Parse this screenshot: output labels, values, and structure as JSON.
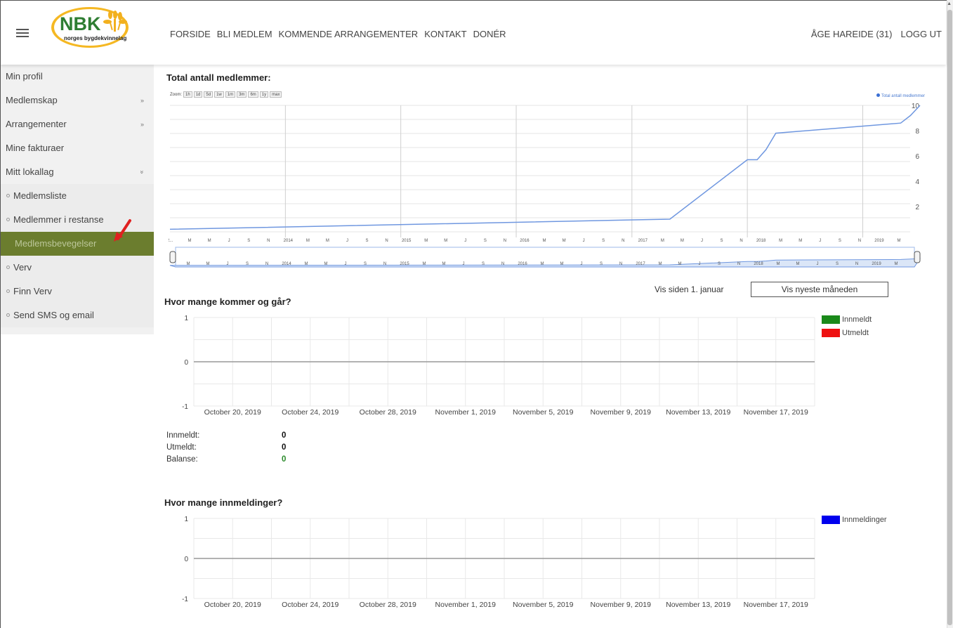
{
  "header": {
    "logo_title": "NBK",
    "logo_subtitle": "norges bygdekvinnelag",
    "nav": [
      "FORSIDE",
      "BLI MEDLEM",
      "KOMMENDE ARRANGEMENTER",
      "KONTAKT",
      "DONÉR"
    ],
    "user": "ÅGE HAREIDE (31)",
    "logout": "LOGG UT"
  },
  "sidebar": {
    "items": [
      {
        "label": "Min profil",
        "arrow": ""
      },
      {
        "label": "Medlemskap",
        "arrow": "»"
      },
      {
        "label": "Arrangementer",
        "arrow": "»"
      },
      {
        "label": "Mine fakturaer",
        "arrow": ""
      },
      {
        "label": "Mitt lokallag",
        "arrow": "»"
      }
    ],
    "sub_items": [
      "Medlemsliste",
      "Medlemmer i restanse",
      "Medlemsbevegelser",
      "Verv",
      "Finn Verv",
      "Send SMS og email"
    ]
  },
  "colors": {
    "accent": "#6b7d2e",
    "line": "#6f97e0",
    "innmeldt": "#1a8a1a",
    "utmeldt": "#ee1111",
    "innmeldinger": "#0000ee"
  },
  "total": {
    "title": "Total antall medlemmer:",
    "zoom_label": "Zoom:",
    "zoom_buttons": [
      "1h",
      "1d",
      "5d",
      "1w",
      "1m",
      "3m",
      "6m",
      "1y",
      "max"
    ],
    "legend": "Total antall medlemmer",
    "y_ticks": [
      "10",
      "8",
      "6",
      "4",
      "2"
    ],
    "x_ticks": [
      "2...",
      "M",
      "M",
      "J",
      "S",
      "N",
      "2014",
      "M",
      "M",
      "J",
      "S",
      "N",
      "2015",
      "M",
      "M",
      "J",
      "S",
      "N",
      "2016",
      "M",
      "M",
      "J",
      "S",
      "N",
      "2017",
      "M",
      "M",
      "J",
      "S",
      "N",
      "2018",
      "M",
      "M",
      "J",
      "S",
      "N",
      "2019",
      "M"
    ],
    "nav_ticks": [
      "M",
      "M",
      "J",
      "S",
      "N",
      "2014",
      "M",
      "M",
      "J",
      "S",
      "N",
      "2015",
      "M",
      "M",
      "J",
      "S",
      "N",
      "2016",
      "M",
      "M",
      "J",
      "S",
      "N",
      "2017",
      "M",
      "M",
      "J",
      "S",
      "N",
      "2018",
      "M",
      "M",
      "J",
      "S",
      "N",
      "2019",
      "M"
    ]
  },
  "chart_data": [
    {
      "type": "line",
      "title": "Total antall medlemmer:",
      "series": [
        {
          "name": "Total antall medlemmer",
          "x": [
            "2013-01",
            "2017-05",
            "2018-01",
            "2018-02",
            "2018-03",
            "2018-04",
            "2019-05",
            "2019-06",
            "2019-07"
          ],
          "values": [
            0.2,
            1.0,
            5.7,
            5.7,
            6.5,
            7.8,
            8.6,
            9.2,
            10
          ]
        }
      ],
      "ylim": [
        0,
        10
      ]
    },
    {
      "type": "bar",
      "title": "Hvor mange kommer og går?",
      "categories": [
        "October 20, 2019",
        "October 24, 2019",
        "October 28, 2019",
        "November 1, 2019",
        "November 5, 2019",
        "November 9, 2019",
        "November 13, 2019",
        "November 17, 2019"
      ],
      "series": [
        {
          "name": "Innmeldt",
          "values": [
            0,
            0,
            0,
            0,
            0,
            0,
            0,
            0
          ]
        },
        {
          "name": "Utmeldt",
          "values": [
            0,
            0,
            0,
            0,
            0,
            0,
            0,
            0
          ]
        }
      ],
      "ylim": [
        -1,
        1
      ],
      "y_ticks": [
        "1",
        "0",
        "-1"
      ]
    },
    {
      "type": "bar",
      "title": "Hvor mange innmeldinger?",
      "categories": [
        "October 20, 2019",
        "October 24, 2019",
        "October 28, 2019",
        "November 1, 2019",
        "November 5, 2019",
        "November 9, 2019",
        "November 13, 2019",
        "November 17, 2019"
      ],
      "series": [
        {
          "name": "Innmeldinger",
          "values": [
            0,
            0,
            0,
            0,
            0,
            0,
            0,
            0
          ]
        }
      ],
      "ylim": [
        -1,
        1
      ],
      "y_ticks": [
        "1",
        "0",
        "-1"
      ]
    }
  ],
  "controls": {
    "vis_siden": "Vis siden 1. januar",
    "vis_nyeste": "Vis nyeste måneden"
  },
  "stats": {
    "innmeldt_label": "Innmeldt:",
    "innmeldt_value": "0",
    "utmeldt_label": "Utmeldt:",
    "utmeldt_value": "0",
    "balanse_label": "Balanse:",
    "balanse_value": "0"
  }
}
